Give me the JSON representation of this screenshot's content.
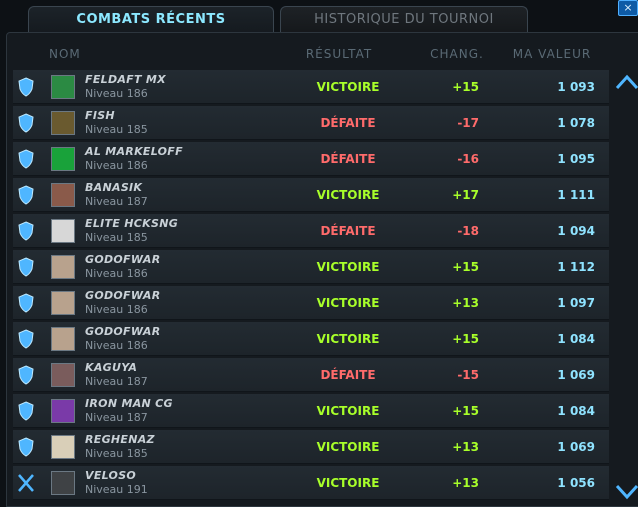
{
  "tabs": {
    "active": "COMBATS RÉCENTS",
    "inactive": "HISTORIQUE DU TOURNOI"
  },
  "window": {
    "close_glyph": "×"
  },
  "header": {
    "name": "NOM",
    "result": "RÉSULTAT",
    "change": "CHANG.",
    "value": "MA VALEUR"
  },
  "rows": [
    {
      "name": "FELDAFT MX",
      "level": "Niveau 186",
      "result": "VICTOIRE",
      "change": "+15",
      "value": "1 093",
      "outcome": "win",
      "icon": "shield-icon",
      "avatar": "#2b8a43"
    },
    {
      "name": "FISH",
      "level": "Niveau 185",
      "result": "DÉFAITE",
      "change": "-17",
      "value": "1 078",
      "outcome": "lose",
      "icon": "shield-icon",
      "avatar": "#6a5a2f"
    },
    {
      "name": "AL MARKELOFF",
      "level": "Niveau 186",
      "result": "DÉFAITE",
      "change": "-16",
      "value": "1 095",
      "outcome": "lose",
      "icon": "shield-icon",
      "avatar": "#19a23a"
    },
    {
      "name": "BANASIK",
      "level": "Niveau 187",
      "result": "VICTOIRE",
      "change": "+17",
      "value": "1 111",
      "outcome": "win",
      "icon": "shield-icon",
      "avatar": "#8a5a4a"
    },
    {
      "name": "ELITE HCKSNG",
      "level": "Niveau 185",
      "result": "DÉFAITE",
      "change": "-18",
      "value": "1 094",
      "outcome": "lose",
      "icon": "shield-icon",
      "avatar": "#d7d7d7"
    },
    {
      "name": "GODOFWAR",
      "level": "Niveau 186",
      "result": "VICTOIRE",
      "change": "+15",
      "value": "1 112",
      "outcome": "win",
      "icon": "shield-icon",
      "avatar": "#b8a28d"
    },
    {
      "name": "GODOFWAR",
      "level": "Niveau 186",
      "result": "VICTOIRE",
      "change": "+13",
      "value": "1 097",
      "outcome": "win",
      "icon": "shield-icon",
      "avatar": "#b8a28d"
    },
    {
      "name": "GODOFWAR",
      "level": "Niveau 186",
      "result": "VICTOIRE",
      "change": "+15",
      "value": "1 084",
      "outcome": "win",
      "icon": "shield-icon",
      "avatar": "#b8a28d"
    },
    {
      "name": "KAGUYA",
      "level": "Niveau 187",
      "result": "DÉFAITE",
      "change": "-15",
      "value": "1 069",
      "outcome": "lose",
      "icon": "shield-icon",
      "avatar": "#7a5c5c"
    },
    {
      "name": "IRON MAN CG",
      "level": "Niveau 187",
      "result": "VICTOIRE",
      "change": "+15",
      "value": "1 084",
      "outcome": "win",
      "icon": "shield-icon",
      "avatar": "#7a3aa8"
    },
    {
      "name": "REGHENAZ",
      "level": "Niveau 185",
      "result": "VICTOIRE",
      "change": "+13",
      "value": "1 069",
      "outcome": "win",
      "icon": "shield-icon",
      "avatar": "#d9cfb8"
    },
    {
      "name": "VELOSO",
      "level": "Niveau 191",
      "result": "VICTOIRE",
      "change": "+13",
      "value": "1 056",
      "outcome": "win",
      "icon": "swords-icon",
      "avatar": "#3f4245"
    }
  ],
  "colors": {
    "win": "#a8ff2a",
    "lose": "#ff6b6b",
    "value": "#8fe3ff",
    "accent": "#4fb6ff"
  }
}
